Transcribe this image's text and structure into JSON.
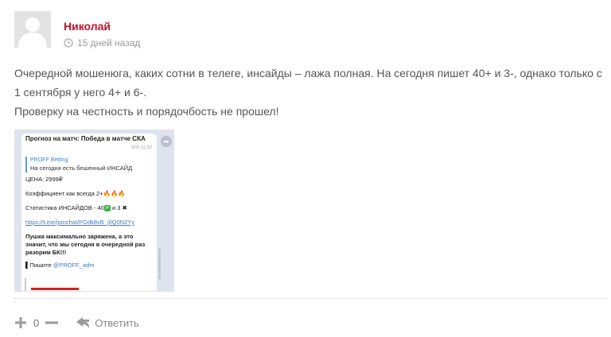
{
  "comment": {
    "author": "Николай",
    "time_ago": "15 дней назад",
    "text_lines": [
      "Очередной мошенюга, каких сотни в телеге, инсайды – лажа полная. На сегодня пишет 40+ и 3-, однако только с 1 сентября у него 4+ и 6-.",
      "Проверку на честность и порядочбость не прошел!"
    ]
  },
  "attachment": {
    "header_title": "Прогноз на матч: Победа в матче СКА",
    "header_meta": "308 11:50",
    "quote_name": "PROFF Betting",
    "quote_text": "На сегодня есть бешенный ИНСАЙД",
    "price": "ЦЕНА: 2999₽",
    "coef": "Коэффициент как всегда 2+",
    "coef_emoji": "🔥🔥🔥",
    "stats_prefix": "Статистика ИНСАЙДОВ - 40",
    "stats_suffix": " и 3",
    "stats_cross": "✖",
    "link": "https://t.me/joinchat/PGdk8vB_j0Q0N2Yy",
    "bold_text": "Пушка максимально заряжена, а это значит, что мы сегодня в очередной раз разорим БК!!!",
    "write_prefix": "Пишите ",
    "write_mention": "@PROFF_adm"
  },
  "actions": {
    "vote_count": "0",
    "reply_label": "Ответить"
  },
  "colors": {
    "author": "#c8102e",
    "meta": "#9a9a9a",
    "text": "#555555"
  },
  "icons": [
    "avatar-placeholder",
    "clock-icon",
    "plus-icon",
    "minus-icon",
    "reply-arrow-icon",
    "share-icon"
  ]
}
